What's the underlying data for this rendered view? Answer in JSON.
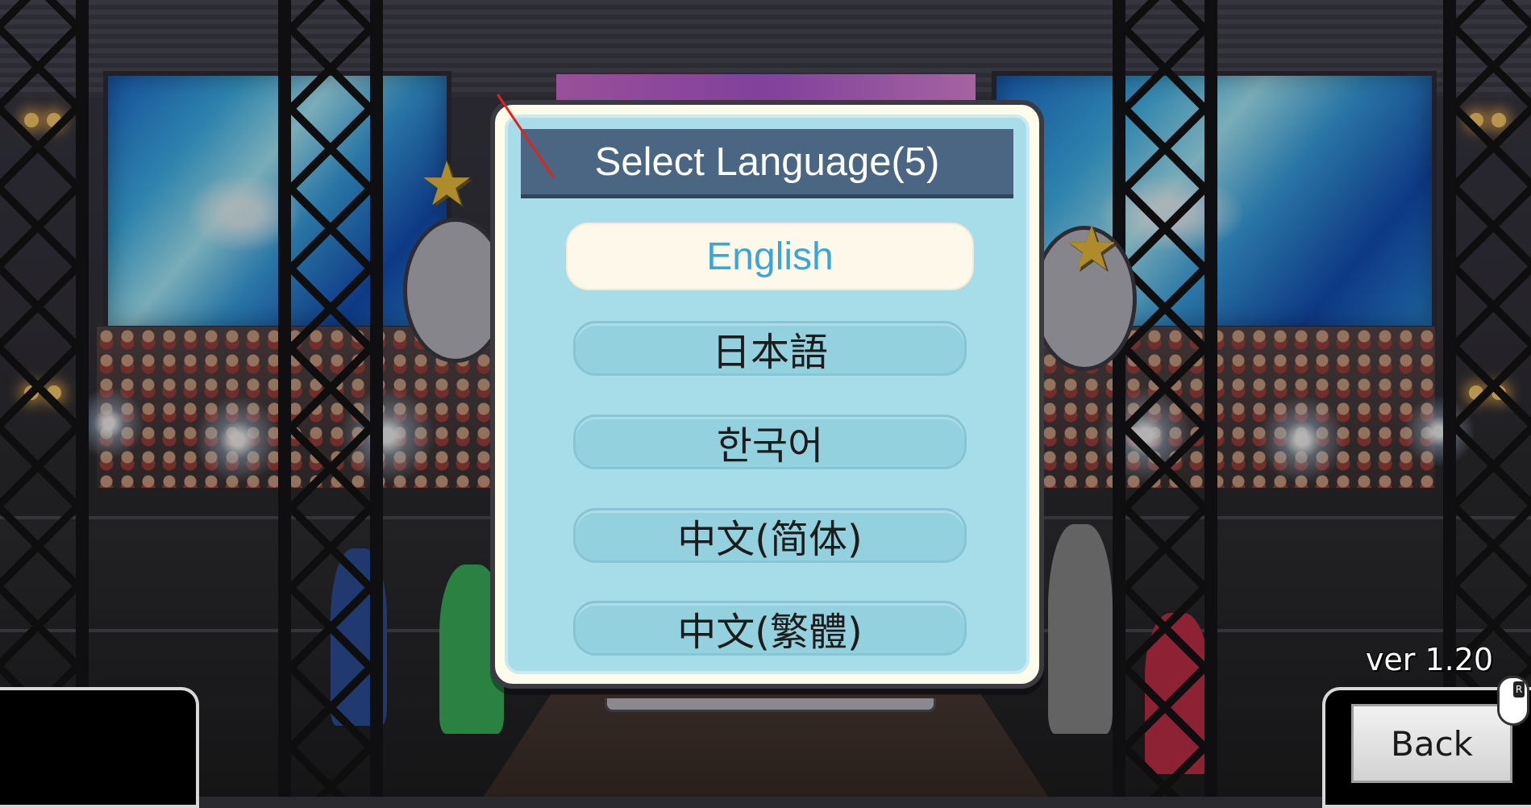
{
  "dialog": {
    "title": "Select Language(5)",
    "options": [
      {
        "label": "English",
        "selected": true
      },
      {
        "label": "日本語",
        "selected": false
      },
      {
        "label": "한국어",
        "selected": false
      },
      {
        "label": "中文(简体)",
        "selected": false
      },
      {
        "label": "中文(繁體)",
        "selected": false
      }
    ]
  },
  "footer": {
    "version": "ver 1.20",
    "back_label": "Back",
    "mouse_badge": "R"
  },
  "colors": {
    "title_bar": "#4b6682",
    "dialog_body": "#a6dde9",
    "selected_option_bg": "#fdf8ea",
    "selected_option_text": "#3aa6d8",
    "option_bg": "#94d1df"
  },
  "icons": {
    "mouse": "mouse-right-click-icon",
    "stars": "star-icon"
  }
}
